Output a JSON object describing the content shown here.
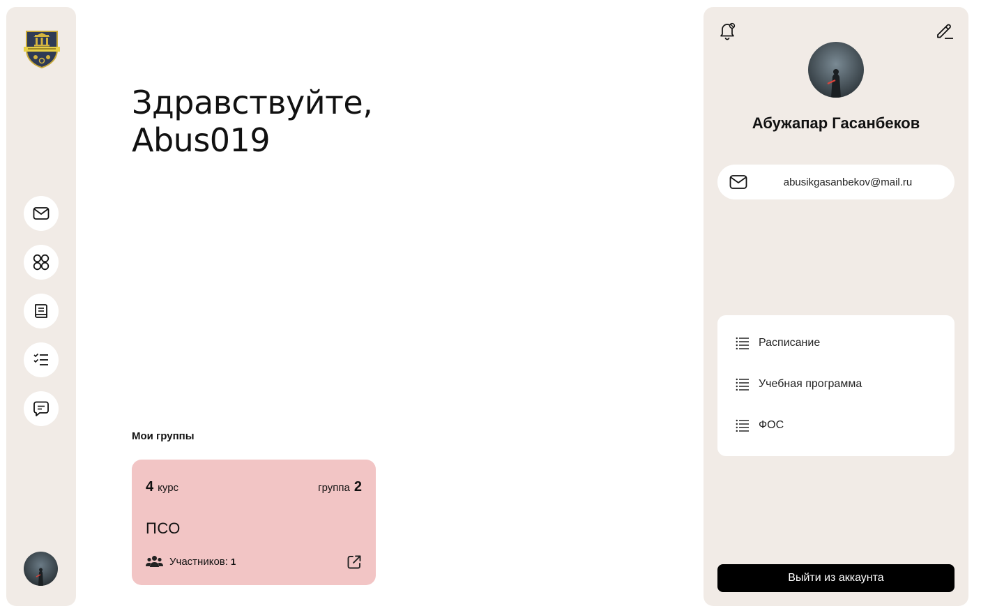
{
  "sidebar": {
    "logo_alt": "college-logo",
    "items": [
      {
        "name": "mail-icon"
      },
      {
        "name": "apps-grid-icon"
      },
      {
        "name": "book-icon"
      },
      {
        "name": "checklist-icon"
      },
      {
        "name": "chat-icon"
      }
    ]
  },
  "greeting": {
    "line1": "Здравствуйте,",
    "line2": "Abus019"
  },
  "groups": {
    "title": "Мои группы",
    "cards": [
      {
        "course_num": "4",
        "course_label": "курс",
        "group_label": "группа",
        "group_num": "2",
        "name": "ПСО",
        "members_label": "Участников:",
        "members_count": "1"
      }
    ]
  },
  "profile": {
    "name": "Абужапар Гасанбеков",
    "email": "abusikgasanbekov@mail.ru",
    "menu": [
      {
        "label": "Расписание"
      },
      {
        "label": "Учебная программа"
      },
      {
        "label": "ФОС"
      }
    ],
    "logout_label": "Выйти из аккаунта"
  },
  "colors": {
    "panel_bg": "#f1ebe6",
    "card_bg": "#f2c5c5",
    "logout_bg": "#000000"
  }
}
